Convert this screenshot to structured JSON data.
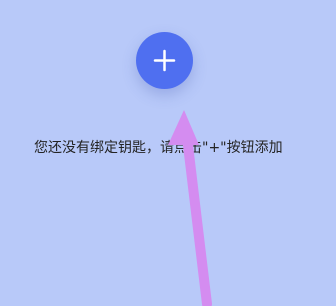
{
  "empty_state": {
    "add_button_label": "+",
    "message": "您还没有绑定钥匙，请点击\"+\"按钮添加"
  },
  "annotation": {
    "arrow_color": "#d48cf0"
  },
  "colors": {
    "background": "#b8c9f9",
    "accent": "#4f6ff0",
    "text": "#242424"
  }
}
